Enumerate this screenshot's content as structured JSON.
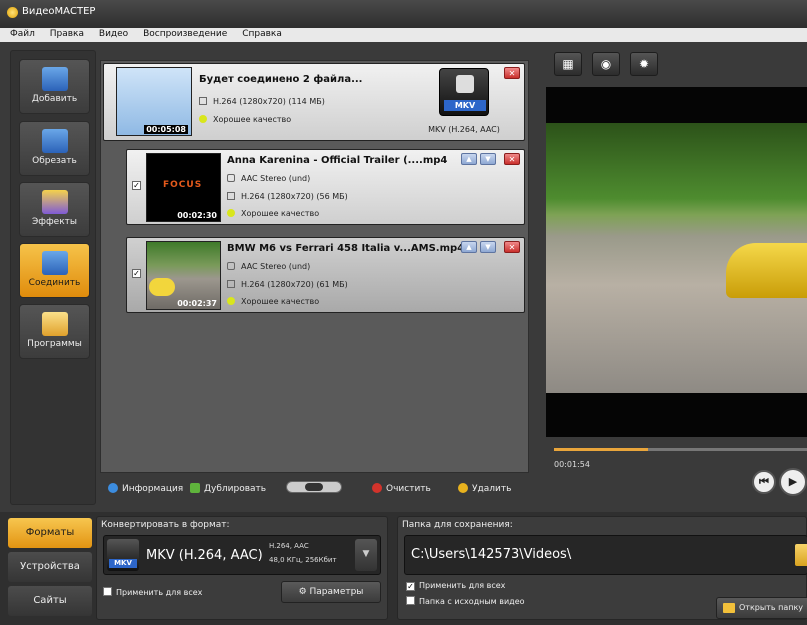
{
  "window": {
    "title": "ВидеоМАСТЕР"
  },
  "menu": [
    "Файл",
    "Правка",
    "Видео",
    "Воспроизведение",
    "Справка"
  ],
  "sidebar": {
    "items": [
      {
        "label": "Добавить",
        "icon": "add-video-icon",
        "active": false
      },
      {
        "label": "Обрезать",
        "icon": "cut-video-icon",
        "active": false
      },
      {
        "label": "Эффекты",
        "icon": "effects-icon",
        "active": false
      },
      {
        "label": "Соединить",
        "icon": "join-video-icon",
        "active": true
      },
      {
        "label": "Программы",
        "icon": "programs-icon",
        "active": false
      }
    ]
  },
  "files": {
    "merged": {
      "title": "Будет соединено 2 файла...",
      "video": "H.264 (1280x720) (114 МБ)",
      "quality": "Хорошее качество",
      "duration": "00:05:08",
      "format_badge": "MKV",
      "format_name": "MKV (H.264, AAC)"
    },
    "items": [
      {
        "title": "Anna Karenina - Official Trailer (....mp4",
        "audio": "AAC Stereo (und)",
        "video": "H.264 (1280x720) (56 МБ)",
        "quality": "Хорошее качество",
        "duration": "00:02:30",
        "thumb_text": "FOCUS",
        "checked": true
      },
      {
        "title": "BMW M6 vs Ferrari 458 Italia v...AMS.mp4",
        "audio": "AAC Stereo (und)",
        "video": "H.264 (1280x720) (61 МБ)",
        "quality": "Хорошее качество",
        "duration": "00:02:37",
        "checked": true
      }
    ]
  },
  "toolbar": {
    "info": "Информация",
    "duplicate": "Дублировать",
    "clear": "Очистить",
    "delete": "Удалить"
  },
  "preview": {
    "time": "00:01:54",
    "tools": [
      "crop-icon",
      "snapshot-icon",
      "brightness-icon"
    ],
    "progress_fraction": 0.37
  },
  "bottom": {
    "tabs": [
      {
        "label": "Форматы",
        "active": true
      },
      {
        "label": "Устройства",
        "active": false
      },
      {
        "label": "Сайты",
        "active": false
      }
    ],
    "format": {
      "label": "Конвертировать в формат:",
      "badge": "MKV",
      "name": "MKV (H.264, AAC)",
      "codec": "H.264, AAC",
      "audio": "48,0 КГц, 256Кбит",
      "apply_all": "Применить для всех",
      "params": "Параметры"
    },
    "save": {
      "label": "Папка для сохранения:",
      "path": "C:\\Users\\142573\\Videos\\",
      "apply_all": "Применить для всех",
      "source_folder": "Папка с исходным видео",
      "open_folder": "Открыть папку"
    }
  },
  "colors": {
    "accent": "#e9a53b",
    "active_tab": "#f4b93a",
    "close": "#c9302c",
    "format_blue": "#2d66c9"
  }
}
